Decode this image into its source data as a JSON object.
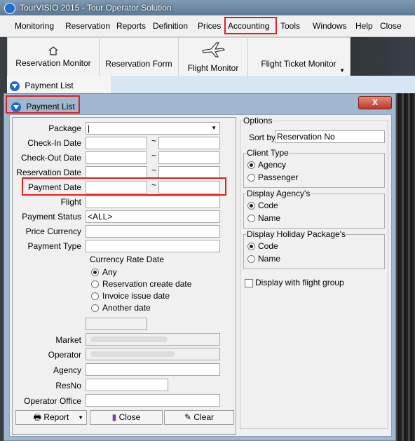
{
  "app": {
    "title": "TourVISIO 2015 - Tour Operator Solution"
  },
  "menu": [
    "Monitoring",
    "Reservation",
    "Reports",
    "Definition",
    "Prices",
    "Accounting",
    "Tools",
    "Windows",
    "Help",
    "Close"
  ],
  "toolbar": {
    "reservation_monitor": "Reservation Monitor",
    "reservation_form": "Reservation Form",
    "flight_monitor": "Flight Monitor",
    "flight_ticket_monitor": "Flight Ticket Monitor"
  },
  "tabs": {
    "payment_list_tab": "Payment List"
  },
  "dialog": {
    "title": "Payment List",
    "close": "X"
  },
  "form": {
    "package": "Package",
    "check_in": "Check-In Date",
    "check_out": "Check-Out Date",
    "reservation_date": "Reservation Date",
    "payment_date": "Payment Date",
    "flight": "Flight",
    "payment_status": "Payment Status",
    "payment_status_value": "<ALL>",
    "price_currency": "Price Currency",
    "payment_type": "Payment Type",
    "currency_rate_date": "Currency Rate Date",
    "rate_any": "Any",
    "rate_create": "Reservation create date",
    "rate_invoice": "Invoice issue date",
    "rate_another": "Another date",
    "market": "Market",
    "operator": "Operator",
    "agency": "Agency",
    "resno": "ResNo",
    "operator_office": "Operator Office",
    "tilde": "~"
  },
  "options": {
    "title": "Options",
    "sort_by": "Sort by",
    "sort_by_value": "Reservation No",
    "client_type": "Client Type",
    "agency": "Agency",
    "passenger": "Passenger",
    "display_agency": "Display Agency's",
    "display_holiday": "Display Holiday Package's",
    "code": "Code",
    "name": "Name",
    "display_flight_group": "Display with flight group"
  },
  "buttons": {
    "report": "Report",
    "close": "Close",
    "clear": "Clear"
  }
}
